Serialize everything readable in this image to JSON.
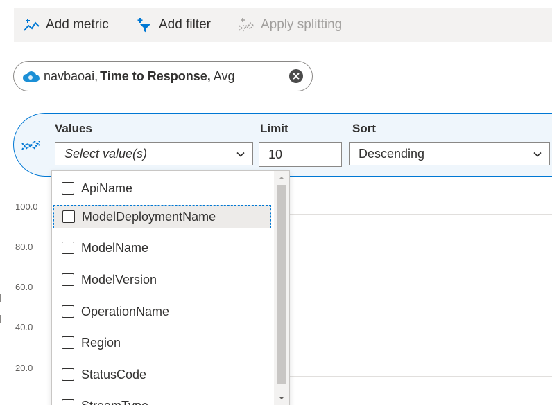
{
  "toolbar": {
    "add_metric": "Add metric",
    "add_filter": "Add filter",
    "apply_splitting": "Apply splitting"
  },
  "metric_pill": {
    "resource": "navbaoai,",
    "metric": "Time to Response,",
    "aggregation": "Avg"
  },
  "splitting": {
    "values_label": "Values",
    "values_placeholder": "Select value(s)",
    "limit_label": "Limit",
    "limit_value": "10",
    "sort_label": "Sort",
    "sort_value": "Descending"
  },
  "chart_axis": {
    "y_ticks": [
      "100.0",
      "80.0",
      "60.0",
      "40.0",
      "20.0"
    ]
  },
  "dimension_options": [
    "ApiName",
    "ModelDeploymentName",
    "ModelName",
    "ModelVersion",
    "OperationName",
    "Region",
    "StatusCode",
    "StreamType"
  ],
  "colors": {
    "accent": "#0078d4",
    "panel_bg": "#eff6fc",
    "toolbar_bg": "#f3f2f1"
  }
}
